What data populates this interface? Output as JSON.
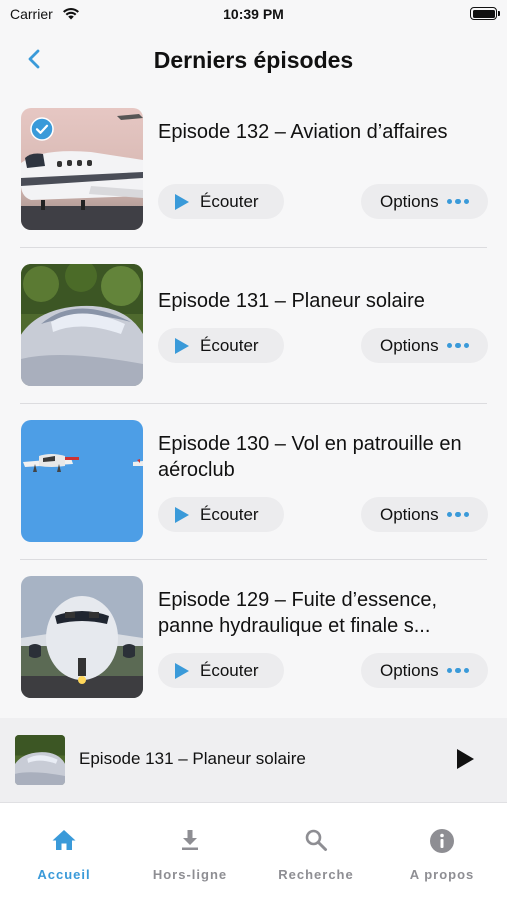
{
  "status": {
    "carrier": "Carrier",
    "time": "10:39 PM"
  },
  "nav": {
    "title": "Derniers épisodes"
  },
  "colors": {
    "accent": "#3a9ad9",
    "pill_bg": "#ececee"
  },
  "episodes": [
    {
      "title": "Episode 132 – Aviation d’affaires",
      "listen": "Écouter",
      "options": "Options",
      "downloaded": true,
      "thumb": "business-jet"
    },
    {
      "title": "Episode 131 – Planeur solaire",
      "listen": "Écouter",
      "options": "Options",
      "downloaded": false,
      "thumb": "solar-glider"
    },
    {
      "title": "Episode 130 – Vol en patrouille en aéroclub",
      "listen": "Écouter",
      "options": "Options",
      "downloaded": false,
      "thumb": "formation-planes"
    },
    {
      "title": "Episode 129 – Fuite d’essence, panne hydraulique et finale s...",
      "listen": "Écouter",
      "options": "Options",
      "downloaded": false,
      "thumb": "airliner-front"
    }
  ],
  "player": {
    "title": "Episode 131 – Planeur solaire"
  },
  "tabs": [
    {
      "label": "Accueil",
      "icon": "home-icon",
      "active": true
    },
    {
      "label": "Hors-ligne",
      "icon": "download-icon",
      "active": false
    },
    {
      "label": "Recherche",
      "icon": "search-icon",
      "active": false
    },
    {
      "label": "A propos",
      "icon": "info-icon",
      "active": false
    }
  ]
}
